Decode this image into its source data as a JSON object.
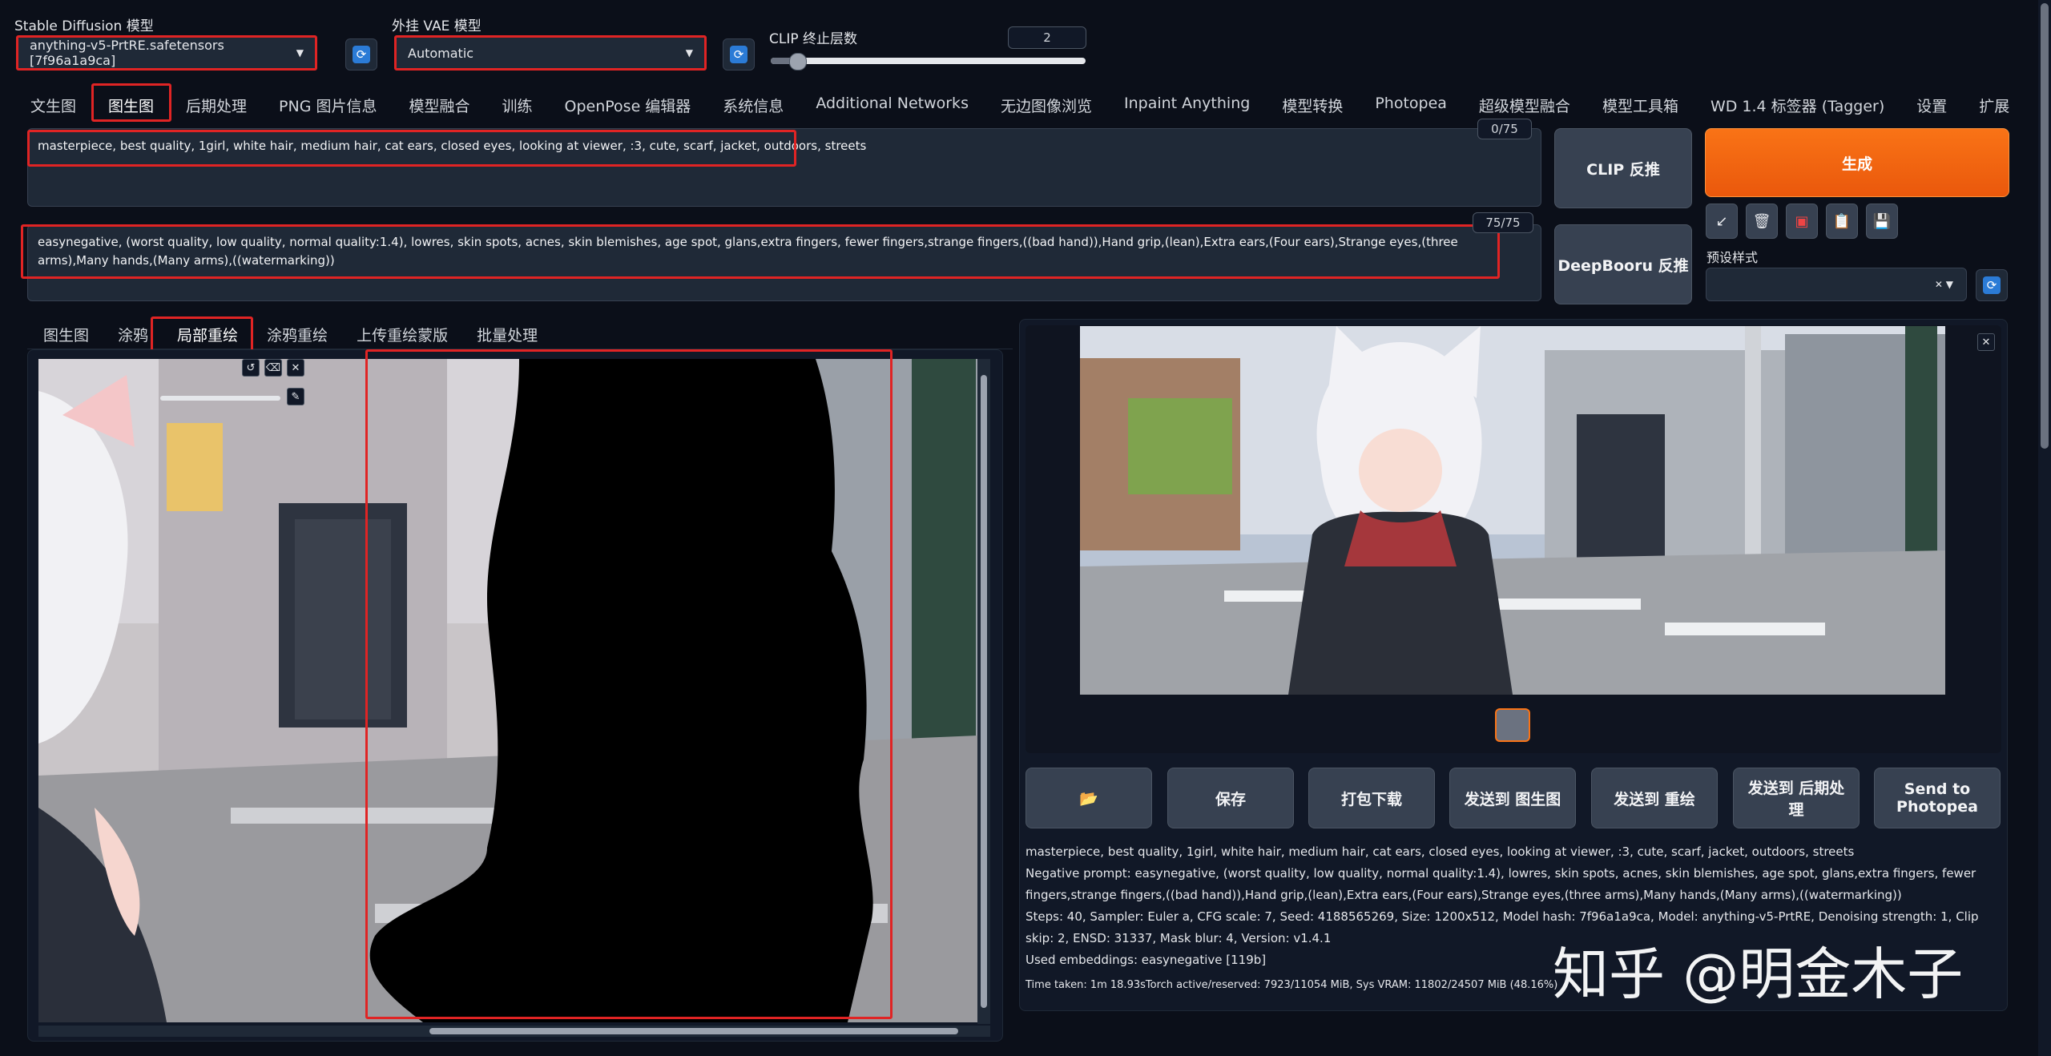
{
  "header": {
    "model_label": "Stable Diffusion 模型",
    "model_value": "anything-v5-PrtRE.safetensors [7f96a1a9ca]",
    "vae_label": "外挂 VAE 模型",
    "vae_value": "Automatic",
    "clip_label": "CLIP 终止层数",
    "clip_value": "2",
    "clip_fraction": 0.083
  },
  "tabs": [
    "文生图",
    "图生图",
    "后期处理",
    "PNG 图片信息",
    "模型融合",
    "训练",
    "OpenPose 编辑器",
    "系统信息",
    "Additional Networks",
    "无边图像浏览",
    "Inpaint Anything",
    "模型转换",
    "Photopea",
    "超级模型融合",
    "模型工具箱",
    "WD 1.4 标签器 (Tagger)",
    "设置",
    "扩展"
  ],
  "active_tab": "图生图",
  "prompt": {
    "positive": "masterpiece, best quality, 1girl, white hair, medium hair, cat ears, closed eyes, looking at viewer, :3, cute, scarf, jacket, outdoors, streets",
    "positive_count": "0/75",
    "negative": "easynegative, (worst quality, low quality, normal quality:1.4), lowres, skin spots, acnes, skin blemishes, age spot, glans,extra fingers, fewer fingers,strange fingers,((bad hand)),Hand grip,(lean),Extra ears,(Four ears),Strange eyes,(three arms),Many hands,(Many arms),((watermarking))",
    "negative_count": "75/75"
  },
  "actions": {
    "clip_interrogate": "CLIP 反推",
    "deepbooru_interrogate": "DeepBooru 反推",
    "generate": "生成",
    "style_label": "预设样式"
  },
  "subtabs": [
    "图生图",
    "涂鸦",
    "局部重绘",
    "涂鸦重绘",
    "上传重绘蒙版",
    "批量处理"
  ],
  "active_subtab": "局部重绘",
  "output_buttons": {
    "folder": "📂",
    "save": "保存",
    "zip": "打包下载",
    "send_img2img": "发送到 图生图",
    "send_inpaint": "发送到 重绘",
    "send_extras": "发送到 后期处理",
    "send_photopea": "Send to Photopea"
  },
  "output_info": {
    "prompt": "masterpiece, best quality, 1girl, white hair, medium hair, cat ears, closed eyes, looking at viewer, :3, cute, scarf, jacket, outdoors, streets",
    "negative": "Negative prompt: easynegative, (worst quality, low quality, normal quality:1.4), lowres, skin spots, acnes, skin blemishes, age spot, glans,extra fingers, fewer fingers,strange fingers,((bad hand)),Hand grip,(lean),Extra ears,(Four ears),Strange eyes,(three arms),Many hands,(Many arms),((watermarking))",
    "params": "Steps: 40, Sampler: Euler a, CFG scale: 7, Seed: 4188565269, Size: 1200x512, Model hash: 7f96a1a9ca, Model: anything-v5-PrtRE, Denoising strength: 1, Clip skip: 2, ENSD: 31337, Mask blur: 4, Version: v1.4.1",
    "embeddings": "Used embeddings: easynegative [119b]",
    "time": "Time taken: 1m 18.93sTorch active/reserved: 7923/11054 MiB, Sys VRAM: 11802/24507 MiB (48.16%)"
  },
  "watermark": "知乎 @明金木子",
  "colors": {
    "accent_red": "#e02424",
    "generate_orange": "#f97316",
    "background": "#0b0f19"
  }
}
